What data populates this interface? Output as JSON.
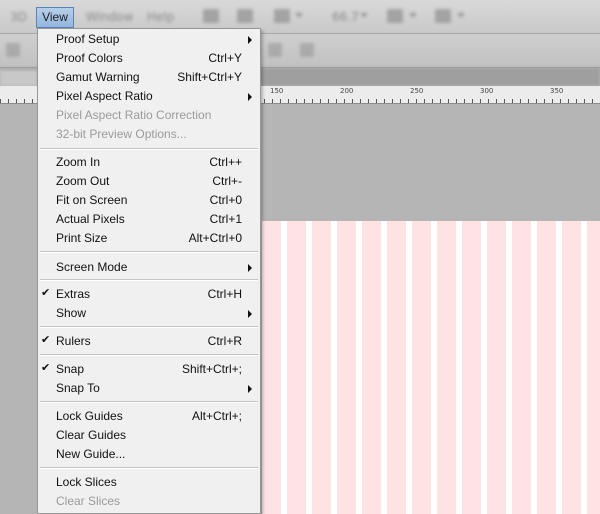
{
  "menubar": {
    "items": [
      "3D",
      "View",
      "Window",
      "Help"
    ],
    "zoom_value": "66.7"
  },
  "view_menu": {
    "items": [
      {
        "label": "Proof Setup",
        "shortcut": "",
        "submenu": true,
        "checked": false,
        "disabled": false
      },
      {
        "label": "Proof Colors",
        "shortcut": "Ctrl+Y",
        "submenu": false,
        "checked": false,
        "disabled": false
      },
      {
        "label": "Gamut Warning",
        "shortcut": "Shift+Ctrl+Y",
        "submenu": false,
        "checked": false,
        "disabled": false
      },
      {
        "label": "Pixel Aspect Ratio",
        "shortcut": "",
        "submenu": true,
        "checked": false,
        "disabled": false
      },
      {
        "label": "Pixel Aspect Ratio Correction",
        "shortcut": "",
        "submenu": false,
        "checked": false,
        "disabled": true
      },
      {
        "label": "32-bit Preview Options...",
        "shortcut": "",
        "submenu": false,
        "checked": false,
        "disabled": true
      },
      {
        "label": "Zoom In",
        "shortcut": "Ctrl++",
        "submenu": false,
        "checked": false,
        "disabled": false
      },
      {
        "label": "Zoom Out",
        "shortcut": "Ctrl+-",
        "submenu": false,
        "checked": false,
        "disabled": false
      },
      {
        "label": "Fit on Screen",
        "shortcut": "Ctrl+0",
        "submenu": false,
        "checked": false,
        "disabled": false
      },
      {
        "label": "Actual Pixels",
        "shortcut": "Ctrl+1",
        "submenu": false,
        "checked": false,
        "disabled": false
      },
      {
        "label": "Print Size",
        "shortcut": "Alt+Ctrl+0",
        "submenu": false,
        "checked": false,
        "disabled": false
      },
      {
        "label": "Screen Mode",
        "shortcut": "",
        "submenu": true,
        "checked": false,
        "disabled": false
      },
      {
        "label": "Extras",
        "shortcut": "Ctrl+H",
        "submenu": false,
        "checked": true,
        "disabled": false
      },
      {
        "label": "Show",
        "shortcut": "",
        "submenu": true,
        "checked": false,
        "disabled": false
      },
      {
        "label": "Rulers",
        "shortcut": "Ctrl+R",
        "submenu": false,
        "checked": true,
        "disabled": false
      },
      {
        "label": "Snap",
        "shortcut": "Shift+Ctrl+;",
        "submenu": false,
        "checked": true,
        "disabled": false
      },
      {
        "label": "Snap To",
        "shortcut": "",
        "submenu": true,
        "checked": false,
        "disabled": false
      },
      {
        "label": "Lock Guides",
        "shortcut": "Alt+Ctrl+;",
        "submenu": false,
        "checked": false,
        "disabled": false
      },
      {
        "label": "Clear Guides",
        "shortcut": "",
        "submenu": false,
        "checked": false,
        "disabled": false
      },
      {
        "label": "New Guide...",
        "shortcut": "",
        "submenu": false,
        "checked": false,
        "disabled": false
      },
      {
        "label": "Lock Slices",
        "shortcut": "",
        "submenu": false,
        "checked": false,
        "disabled": false
      },
      {
        "label": "Clear Slices",
        "shortcut": "",
        "submenu": false,
        "checked": false,
        "disabled": true
      }
    ]
  },
  "colors": {
    "menu_bg": "#f0f0f0",
    "highlight": "#9dbde0",
    "canvas_stripe_pink": "#ffe2e2",
    "canvas_stripe_white": "#ffffff"
  }
}
